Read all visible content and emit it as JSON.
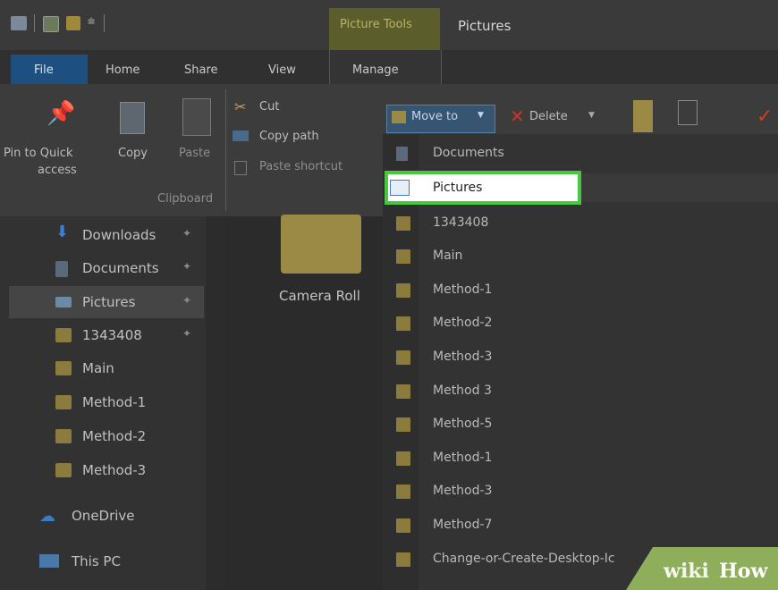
{
  "titlebar": {
    "picture_tools": "Picture Tools",
    "window_title": "Pictures"
  },
  "ribbon_tabs": {
    "file": "File",
    "home": "Home",
    "share": "Share",
    "view": "View",
    "manage": "Manage"
  },
  "clipboard": {
    "pin_to_quick_line1": "Pin to Quick",
    "pin_to_quick_line2": "access",
    "copy": "Copy",
    "paste": "Paste",
    "cut": "Cut",
    "copy_path": "Copy path",
    "paste_shortcut": "Paste shortcut",
    "group_label": "Clipboard"
  },
  "organize": {
    "move_to": "Move to",
    "delete": "Delete"
  },
  "nav_items": [
    {
      "label": "Downloads",
      "icon": "download-arrow-icon",
      "pinned": true
    },
    {
      "label": "Documents",
      "icon": "documents-icon",
      "pinned": true
    },
    {
      "label": "Pictures",
      "icon": "pictures-icon",
      "pinned": true
    },
    {
      "label": "1343408",
      "icon": "folder-icon",
      "pinned": true
    },
    {
      "label": "Main",
      "icon": "folder-icon",
      "pinned": false
    },
    {
      "label": "Method-1",
      "icon": "folder-icon",
      "pinned": false
    },
    {
      "label": "Method-2",
      "icon": "folder-icon",
      "pinned": false
    },
    {
      "label": "Method-3",
      "icon": "folder-icon",
      "pinned": false
    },
    {
      "label": "OneDrive",
      "icon": "cloud-icon",
      "pinned": false
    },
    {
      "label": "This PC",
      "icon": "computer-icon",
      "pinned": false
    }
  ],
  "content": {
    "camera_roll": "Camera Roll"
  },
  "moveto_menu": {
    "documents": "Documents",
    "pictures": "Pictures",
    "items": [
      "1343408",
      "Main",
      "Method-1",
      "Method-2",
      "Method-3",
      "Method 3",
      "Method-5",
      "Method-1",
      "Method-3",
      "Method-7",
      "Change-or-Create-Desktop-Ic"
    ]
  },
  "watermark": {
    "wiki": "wiki",
    "how": "How"
  },
  "colors": {
    "highlight_border": "#47c83e",
    "file_tab": "#1d4f80",
    "picture_tools_tab": "#5b5d2b"
  }
}
